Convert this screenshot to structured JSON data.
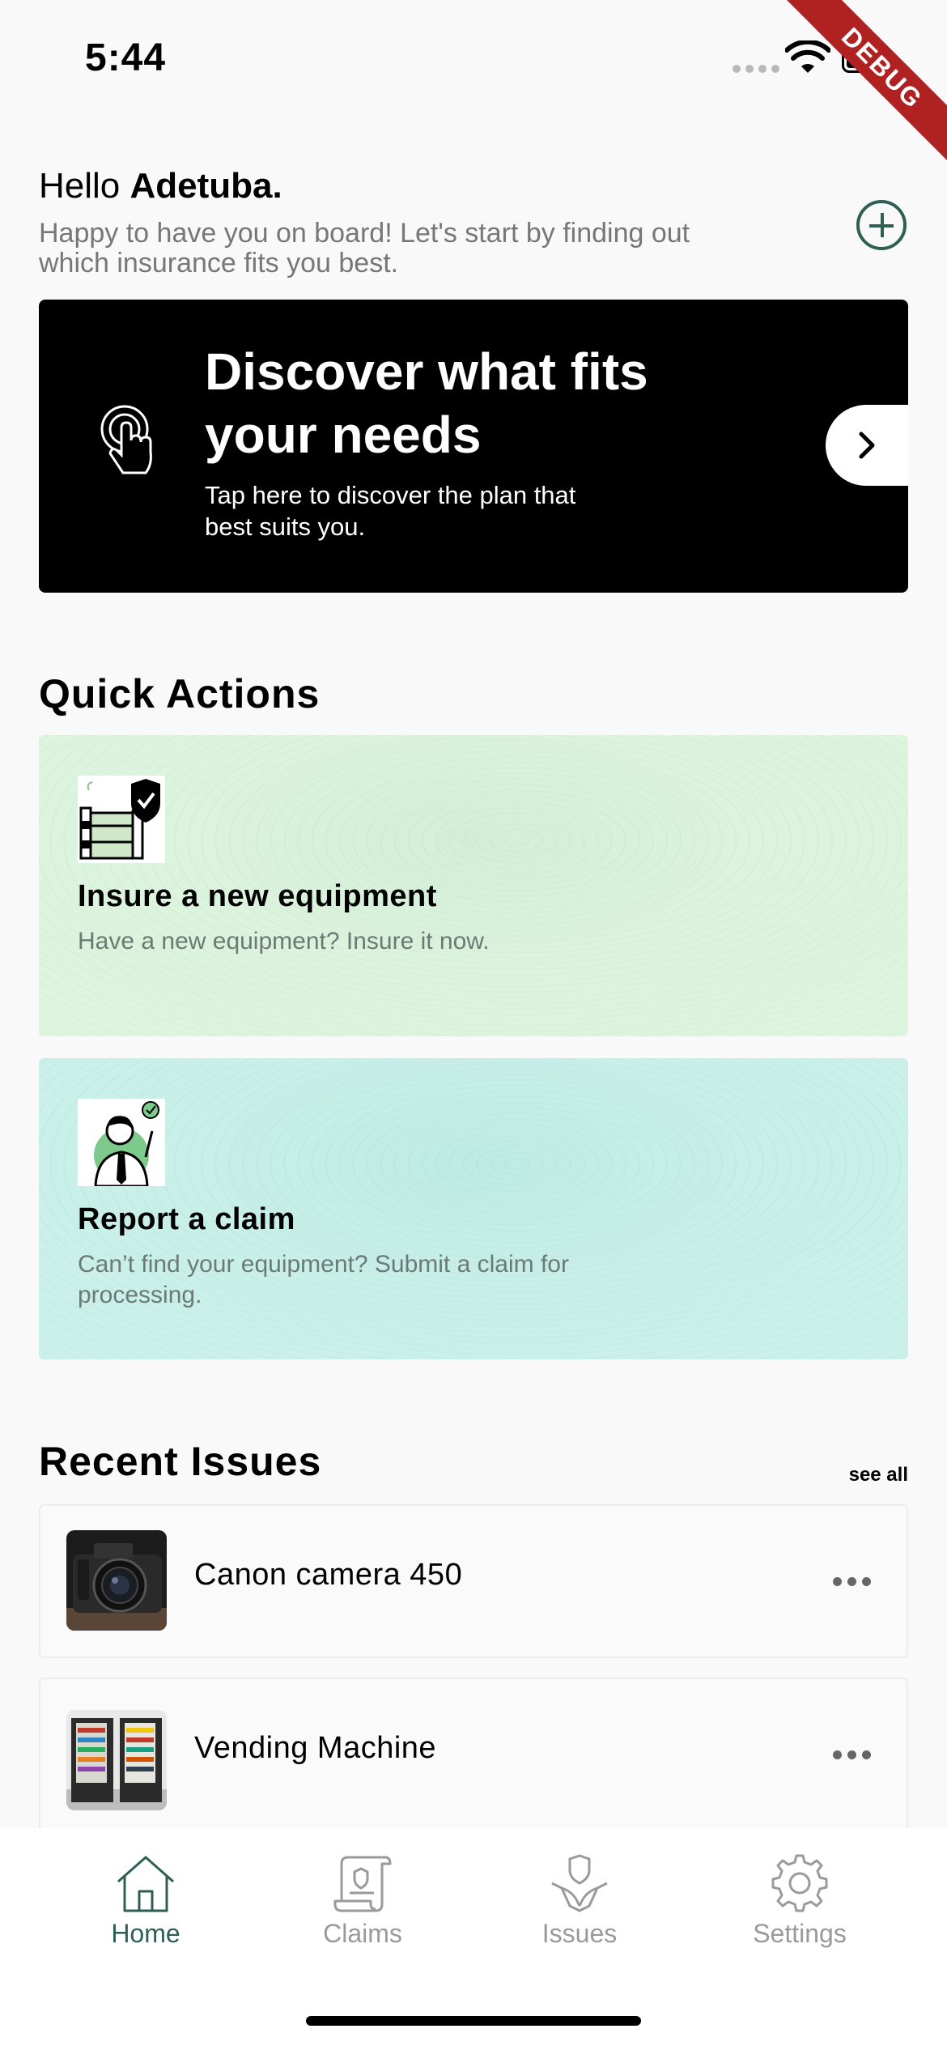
{
  "status_bar": {
    "time": "5:44",
    "debug_label": "DEBUG"
  },
  "greeting": {
    "hello": "Hello",
    "name": "Adetuba.",
    "subtitle": "Happy to have you on board! Let's start by finding out which insurance fits you best."
  },
  "discover": {
    "title": "Discover what fits your needs",
    "subtitle": "Tap here to discover the plan that best suits you.",
    "icon": "touch-icon"
  },
  "quick_actions": {
    "heading": "Quick Actions",
    "items": [
      {
        "title": "Insure a new equipment",
        "description": "Have a new equipment? Insure it now.",
        "icon": "shield-equipment-illustration",
        "color": "#dcf3dd"
      },
      {
        "title": "Report a claim",
        "description": "Can’t find your equipment? Submit a claim for processing.",
        "icon": "man-checkmark-illustration",
        "color": "#c8efe8"
      }
    ]
  },
  "recent_issues": {
    "heading": "Recent Issues",
    "see_all": "see all",
    "items": [
      {
        "name": "Canon camera 450",
        "thumb": "camera-photo"
      },
      {
        "name": "Vending Machine",
        "thumb": "vending-machine-photo"
      }
    ]
  },
  "bottom_nav": {
    "items": [
      {
        "label": "Home",
        "icon": "home-icon",
        "active": true
      },
      {
        "label": "Claims",
        "icon": "claims-icon",
        "active": false
      },
      {
        "label": "Issues",
        "icon": "issues-icon",
        "active": false
      },
      {
        "label": "Settings",
        "icon": "settings-icon",
        "active": false
      }
    ],
    "active_color": "#2f5e53",
    "inactive_color": "#9a9a9a"
  }
}
